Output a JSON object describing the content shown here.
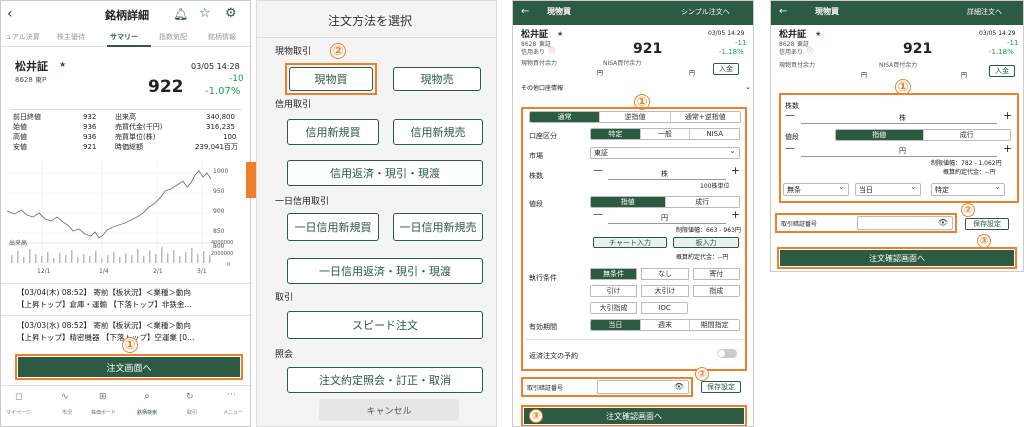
{
  "panel1": {
    "header_title": "銘柄詳細",
    "tabs": [
      "ュアル決算",
      "株主優待",
      "サマリー",
      "指数気配",
      "銘柄情報"
    ],
    "stock_name": "松井証",
    "stock_code": "8628",
    "market": "東P",
    "price": "922",
    "datetime": "03/05 14:28",
    "change": "-10",
    "change_pct": "-1.07%",
    "stats_left": [
      {
        "label": "前日終値",
        "value": "932"
      },
      {
        "label": "始値",
        "value": "936"
      },
      {
        "label": "高値",
        "value": "936"
      },
      {
        "label": "安値",
        "value": "921"
      }
    ],
    "stats_right": [
      {
        "label": "出来高",
        "value": "340,800"
      },
      {
        "label": "売買代金(千円)",
        "value": "316,235"
      },
      {
        "label": "売買単位(株)",
        "value": "100"
      },
      {
        "label": "時価総額",
        "value": "239,041百万"
      }
    ],
    "chart_yticks": [
      "1000",
      "950",
      "900",
      "850",
      "800"
    ],
    "volume_label": "出来高",
    "volume_ticks": [
      "4000000",
      "2000000",
      "0"
    ],
    "chart_xticks": [
      "12/1",
      "1/4",
      "2/1",
      "3/1"
    ],
    "news": [
      {
        "line1": "【03/04(木) 08:52】 寄前【板状況】＜業種＞動向",
        "line2": "【上昇トップ】倉庫・運輸 【下落トップ】非鉄金…"
      },
      {
        "line1": "【03/03(水) 08:52】 寄前【板状況】＜業種＞動向",
        "line2": "【上昇トップ】精密機器 【下落トップ】空運業 [0…"
      }
    ],
    "order_button": "注文画面へ",
    "annotation": "①",
    "bottom_nav": [
      "マイページ",
      "市況",
      "株価ボード",
      "銘柄検索",
      "取引",
      "メニュー"
    ]
  },
  "panel2": {
    "title": "注文方法を選択",
    "section1": "現物取引",
    "btn_buy": "現物買",
    "btn_sell": "現物売",
    "annotation": "②",
    "section2": "信用取引",
    "btn_margin_buy": "信用新規買",
    "btn_margin_sell": "信用新規売",
    "btn_margin_close": "信用返済・現引・現渡",
    "section3": "一日信用取引",
    "btn_day_buy": "一日信用新規買",
    "btn_day_sell": "一日信用新規売",
    "btn_day_close": "一日信用返済・現引・現渡",
    "section4": "取引",
    "btn_speed": "スピード注文",
    "section5": "照会",
    "btn_inquiry": "注文約定照会・訂正・取消",
    "btn_cancel": "キャンセル"
  },
  "panel3": {
    "header_title": "現物買",
    "header_link": "シンプル注文へ",
    "stock_name": "松井証",
    "stock_code": "8628",
    "market": "東証",
    "margin_note": "信用あり",
    "datetime": "03/05 14:29",
    "price": "921",
    "change": "-11",
    "change_pct": "-1.18%",
    "cash_label": "現物買付余力",
    "nisa_label": "NISA買付余力",
    "yen": "円",
    "deposit_btn": "入金",
    "other_info": "その他口座情報",
    "annotation1": "①",
    "order_types": [
      "通常",
      "逆指値",
      "通常+逆指値"
    ],
    "account_label": "口座区分",
    "account_opts": [
      "特定",
      "一般",
      "NISA"
    ],
    "market_label": "市場",
    "market_value": "東証",
    "qty_label": "株数",
    "qty_unit": "株",
    "qty_note": "100株単位",
    "price_label": "値段",
    "price_opts": [
      "指値",
      "成行"
    ],
    "price_unit": "円",
    "limit_note": "制限値幅：663 - 963円",
    "chart_input": "チャート入力",
    "board_input": "板入力",
    "est_amount": "概算約定代金：--円",
    "exec_label": "執行条件",
    "exec_opts_row1": [
      "無条件",
      "なし",
      "寄付"
    ],
    "exec_opts_row2": [
      "引け",
      "大引け",
      "指成"
    ],
    "exec_opts_row3": [
      "大引指成",
      "IOC"
    ],
    "period_label": "有効期間",
    "period_opts": [
      "当日",
      "週末",
      "期間指定"
    ],
    "repeat_label": "返済注文の予約",
    "pin_label": "取引暗証番号",
    "save_btn": "保存設定",
    "annotation2": "②",
    "confirm_btn": "注文確認画面へ",
    "annotation3": "③"
  },
  "panel4": {
    "header_title": "現物買",
    "header_link": "詳細注文へ",
    "stock_name": "松井証",
    "stock_code": "8628",
    "market": "東証",
    "margin_note": "信用あり",
    "datetime": "03/05 14:29",
    "price": "921",
    "change": "-11",
    "change_pct": "-1.18%",
    "cash_label": "現物買付余力",
    "nisa_label": "NISA買付余力",
    "yen": "円",
    "deposit_btn": "入金",
    "annotation1": "①",
    "qty_label": "株数",
    "qty_unit": "株",
    "price_label": "値段",
    "price_opts": [
      "指値",
      "成行"
    ],
    "price_unit": "円",
    "limit_note": "制限値幅：782 - 1,062円",
    "est_amount": "概算約定代金：--円",
    "dd1": "無条",
    "dd2": "当日",
    "dd3": "特定",
    "pin_label": "取引暗証番号",
    "save_btn": "保存設定",
    "annotation2": "②",
    "annotation3": "③",
    "confirm_btn": "注文確認画面へ"
  },
  "colors": {
    "accent": "#2c5a43",
    "annotation": "#f07f2a",
    "gain": "#18a34a"
  }
}
